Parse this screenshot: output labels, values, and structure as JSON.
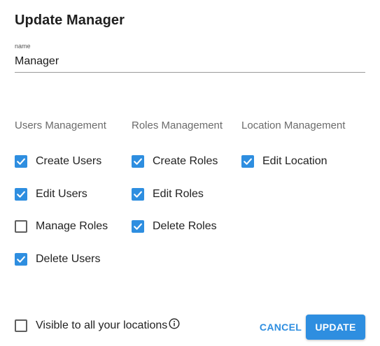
{
  "dialog": {
    "title": "Update Manager",
    "name_field": {
      "label": "name",
      "value": "Manager"
    }
  },
  "columns": {
    "users": {
      "header": "Users Management",
      "items": [
        {
          "label": "Create Users",
          "checked": true
        },
        {
          "label": "Edit Users",
          "checked": true
        },
        {
          "label": "Manage Roles",
          "checked": false
        },
        {
          "label": "Delete Users",
          "checked": true
        }
      ]
    },
    "roles": {
      "header": "Roles Management",
      "items": [
        {
          "label": "Create Roles",
          "checked": true
        },
        {
          "label": "Edit Roles",
          "checked": true
        },
        {
          "label": "Delete Roles",
          "checked": true
        }
      ]
    },
    "location": {
      "header": "Location Management",
      "items": [
        {
          "label": "Edit Location",
          "checked": true
        }
      ]
    }
  },
  "footer": {
    "visible_label": "Visible to all your locations",
    "visible_checked": false,
    "info_icon": "info-icon",
    "cancel_label": "CANCEL",
    "update_label": "UPDATE"
  },
  "colors": {
    "accent": "#2e8ee0",
    "text": "#222222",
    "muted": "#6b6b6b"
  }
}
